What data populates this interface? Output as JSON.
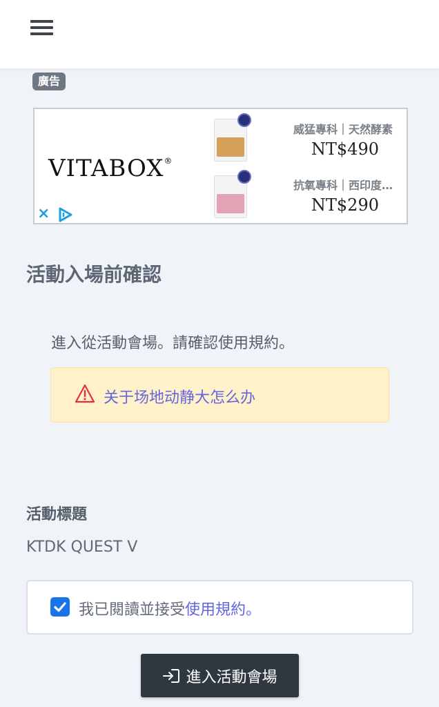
{
  "ad": {
    "badge": "廣告",
    "brand": "VITABOX",
    "brand_mark": "®",
    "products": [
      {
        "title": "威猛專科｜天然酵素",
        "price": "NT$490",
        "color": "#d4a05a"
      },
      {
        "title": "抗氧專科｜西印度櫻桃",
        "price": "NT$290",
        "color": "#e3a3b4"
      }
    ],
    "close_icon": "×",
    "accent_color": "#1a9fe0"
  },
  "page": {
    "title": "活動入場前確認",
    "intro": "進入從活動會場。請確認使用規約。",
    "alert_link": "关于场地动静大怎么办",
    "event_label": "活動標題",
    "event_value": "KTDK QUEST V",
    "agree_prefix": "我已閱讀並接受",
    "agree_link": "使用規約",
    "agree_suffix": "。",
    "enter_button": "進入活動會場",
    "agreed": true
  }
}
